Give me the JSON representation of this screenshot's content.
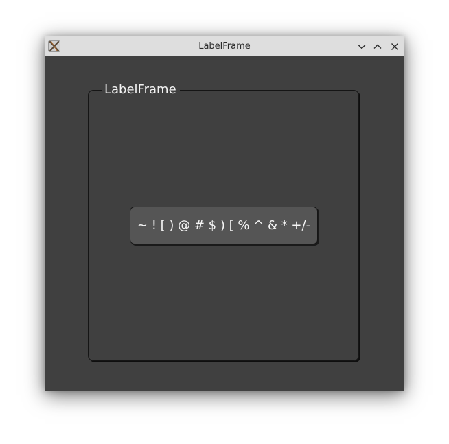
{
  "window": {
    "title": "LabelFrame",
    "app_icon": "x11-app-icon",
    "controls": {
      "minimize_icon": "chevron-down-icon",
      "maximize_icon": "chevron-up-icon",
      "close_icon": "close-icon"
    }
  },
  "labelframe": {
    "label": "LabelFrame"
  },
  "button": {
    "label": "~ ! [ ) @ # $ ) [ % ^ & * +/-"
  },
  "colors": {
    "window_bg": "#404040",
    "titlebar_bg": "#dedede",
    "button_bg": "#555555",
    "text": "#f2f2f2"
  }
}
